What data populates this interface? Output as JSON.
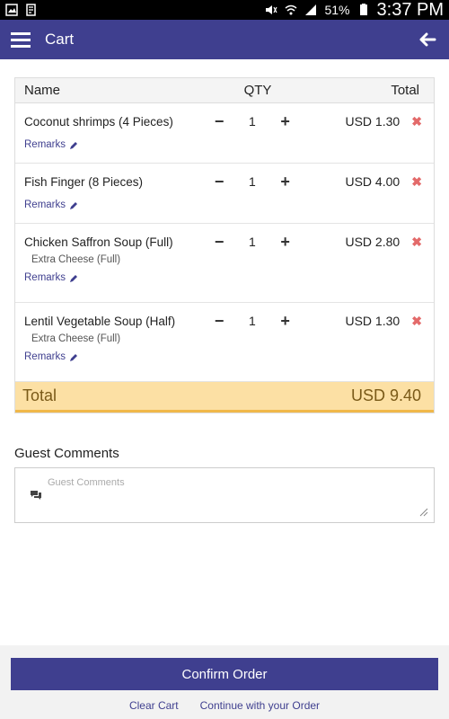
{
  "status_bar": {
    "battery": "51%",
    "time": "3:37 PM"
  },
  "app_bar": {
    "title": "Cart"
  },
  "cart": {
    "headers": {
      "name": "Name",
      "qty": "QTY",
      "total": "Total"
    },
    "items": [
      {
        "name": "Coconut shrimps (4 Pieces)",
        "qty": "1",
        "price": "USD 1.30",
        "addon": "",
        "remarks": "Remarks"
      },
      {
        "name": "Fish Finger (8 Pieces)",
        "qty": "1",
        "price": "USD 4.00",
        "addon": "",
        "remarks": "Remarks"
      },
      {
        "name": "Chicken Saffron Soup (Full)",
        "qty": "1",
        "price": "USD 2.80",
        "addon": "Extra Cheese (Full)",
        "remarks": "Remarks"
      },
      {
        "name": "Lentil Vegetable Soup (Half)",
        "qty": "1",
        "price": "USD 1.30",
        "addon": "Extra Cheese (Full)",
        "remarks": "Remarks"
      }
    ],
    "total_label": "Total",
    "total_value": "USD 9.40"
  },
  "guest_comments": {
    "title": "Guest Comments",
    "placeholder": "Guest Comments"
  },
  "bottom": {
    "confirm": "Confirm Order",
    "clear": "Clear Cart",
    "continue": "Continue with your Order"
  },
  "colors": {
    "primary": "#3f3f8f",
    "total_bg": "#fce0a4",
    "remove": "#e36a6a"
  }
}
